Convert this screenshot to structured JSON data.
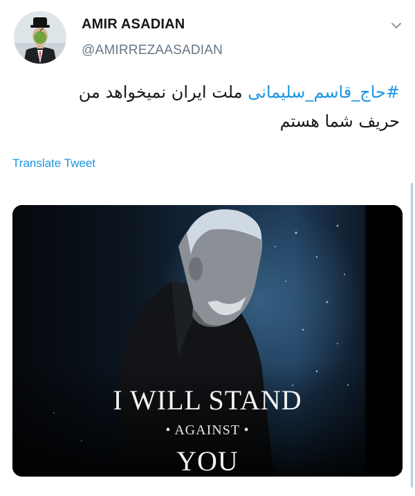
{
  "user": {
    "display_name": "AMIR ASADIAN",
    "handle": "@AMIRREZAASADIAN"
  },
  "tweet": {
    "hashtag": "#حاج_قاسم_سلیمانی",
    "text_line1": " ملت ایران نمیخواهد من",
    "text_line2": "حریف شما هستم",
    "translate_label": "Translate Tweet"
  },
  "media": {
    "line1": "I WILL STAND",
    "line2": "• AGAINST •",
    "line3": "YOU"
  },
  "icons": {
    "caret": "chevron-down-icon"
  },
  "colors": {
    "link": "#1b95e0",
    "text": "#14171a",
    "muted": "#657786",
    "scroll_accent": "#a7d1ee"
  }
}
